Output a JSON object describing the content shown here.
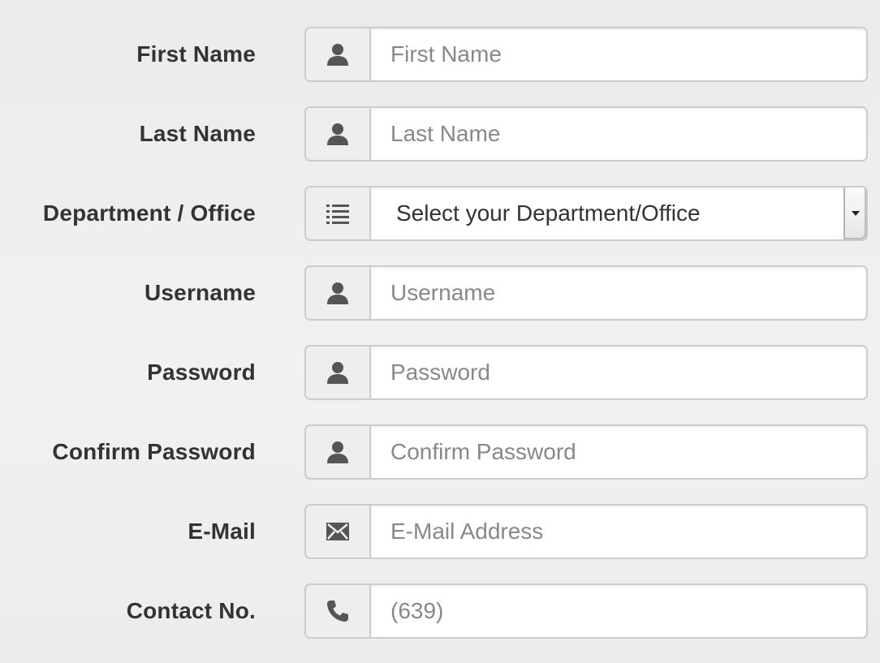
{
  "form": {
    "first_name": {
      "label": "First Name",
      "placeholder": "First Name",
      "icon": "user-icon"
    },
    "last_name": {
      "label": "Last Name",
      "placeholder": "Last Name",
      "icon": "user-icon"
    },
    "department": {
      "label": "Department / Office",
      "selected": "Select your Department/Office",
      "icon": "list-icon"
    },
    "username": {
      "label": "Username",
      "placeholder": "Username",
      "icon": "user-icon"
    },
    "password": {
      "label": "Password",
      "placeholder": "Password",
      "icon": "user-icon"
    },
    "confirm_password": {
      "label": "Confirm Password",
      "placeholder": "Confirm Password",
      "icon": "user-icon"
    },
    "email": {
      "label": "E-Mail",
      "placeholder": "E-Mail Address",
      "icon": "envelope-icon"
    },
    "contact": {
      "label": "Contact No.",
      "placeholder": "(639)",
      "icon": "phone-icon"
    }
  },
  "colors": {
    "label_text": "#333333",
    "placeholder_text": "#888888",
    "addon_bg": "#eeeeee",
    "border": "#cccccc",
    "icon": "#555555"
  }
}
